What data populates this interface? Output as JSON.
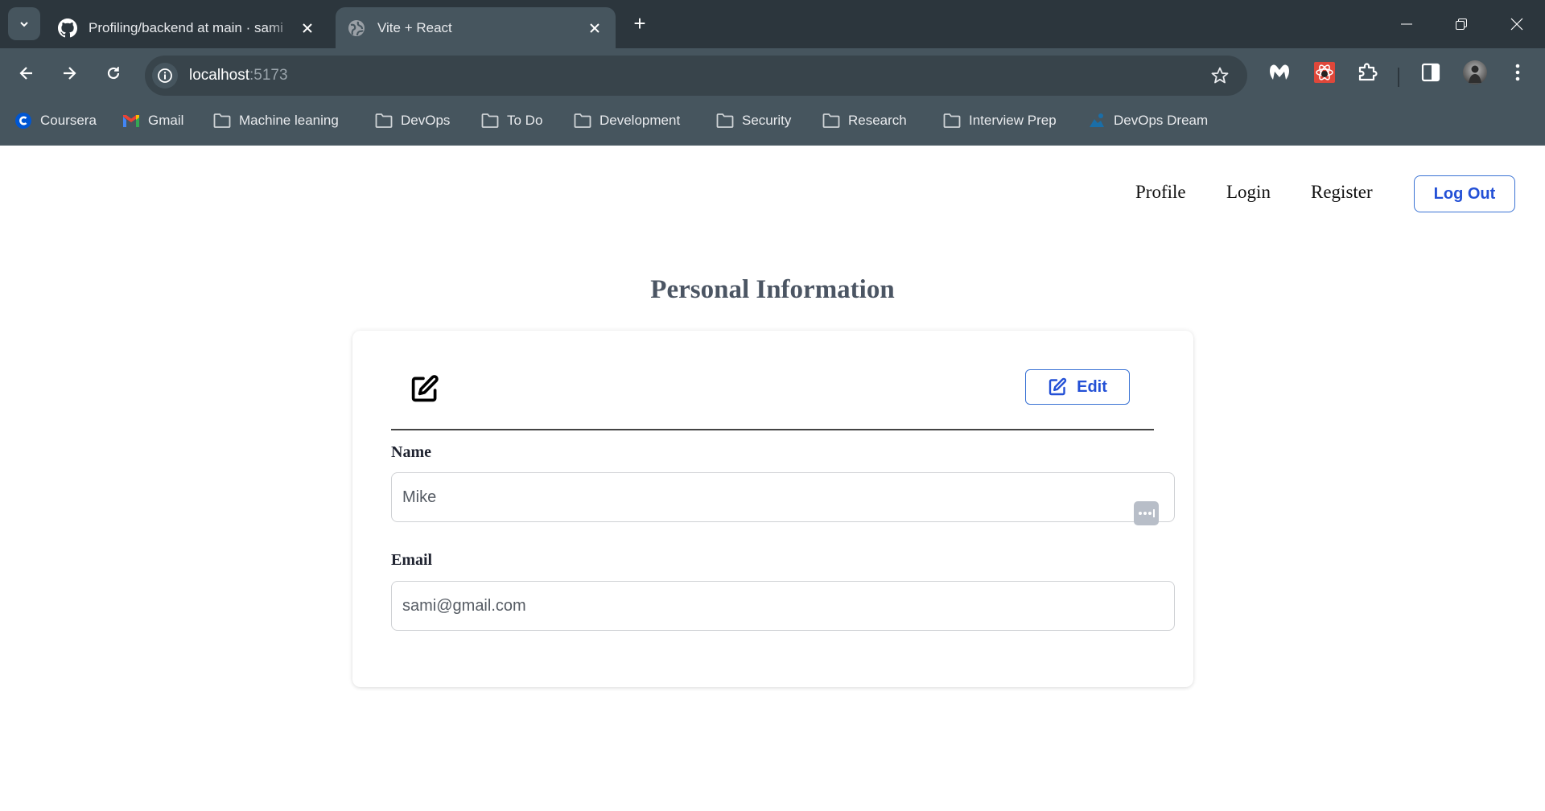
{
  "browser": {
    "tabs": [
      {
        "title": "Profiling/backend at main · sami",
        "icon": "github-icon",
        "active": false
      },
      {
        "title": "Vite + React",
        "icon": "globe-icon",
        "active": true
      }
    ],
    "new_tab_label": "+",
    "address": {
      "host": "localhost",
      "port": ":5173"
    },
    "bookmarks": [
      {
        "label": "Coursera",
        "icon": "coursera-icon"
      },
      {
        "label": "Gmail",
        "icon": "gmail-icon"
      },
      {
        "label": "Machine leaning",
        "icon": "folder-icon"
      },
      {
        "label": "DevOps",
        "icon": "folder-icon"
      },
      {
        "label": "To Do",
        "icon": "folder-icon"
      },
      {
        "label": "Development",
        "icon": "folder-icon"
      },
      {
        "label": "Security",
        "icon": "folder-icon"
      },
      {
        "label": "Research",
        "icon": "folder-icon"
      },
      {
        "label": "Interview Prep",
        "icon": "folder-icon"
      },
      {
        "label": "DevOps Dream",
        "icon": "devops-dream-icon"
      }
    ]
  },
  "nav": {
    "links": [
      "Profile",
      "Login",
      "Register"
    ],
    "logout_label": "Log Out",
    "accent_color": "#2350d6"
  },
  "main": {
    "title": "Personal Information",
    "edit_label": "Edit",
    "fields": [
      {
        "label": "Name",
        "value": "Mike"
      },
      {
        "label": "Email",
        "value": "sami@gmail.com"
      }
    ]
  }
}
